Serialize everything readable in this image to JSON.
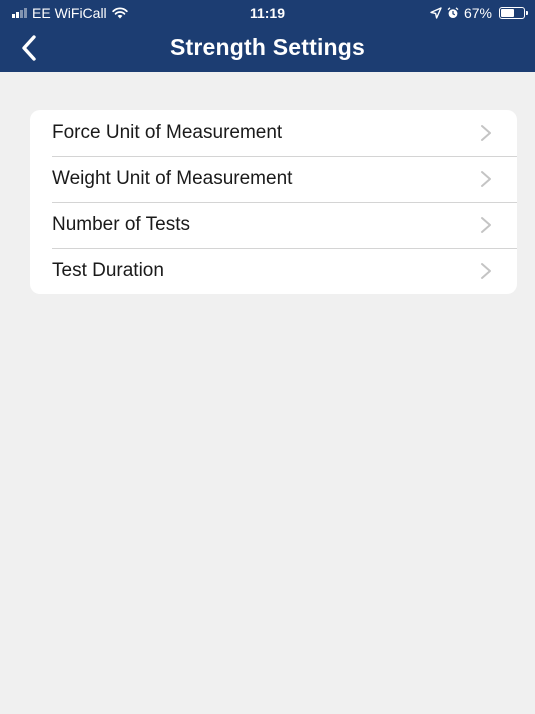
{
  "status_bar": {
    "carrier": "EE WiFiCall",
    "time": "11:19",
    "battery": "67%",
    "battery_level": 0.67
  },
  "nav": {
    "back_icon": "chevron-left-icon",
    "title": "Strength Settings"
  },
  "settings": {
    "rows": [
      {
        "label": "Force Unit of Measurement",
        "icon": "chevron-right-icon"
      },
      {
        "label": "Weight Unit of Measurement",
        "icon": "chevron-right-icon"
      },
      {
        "label": "Number of Tests",
        "icon": "chevron-right-icon"
      },
      {
        "label": "Test Duration",
        "icon": "chevron-right-icon"
      }
    ]
  },
  "colors": {
    "header": "#1c3d72",
    "background": "#f0f0f0",
    "card": "#ffffff",
    "chevron": "#c4c4c4"
  }
}
